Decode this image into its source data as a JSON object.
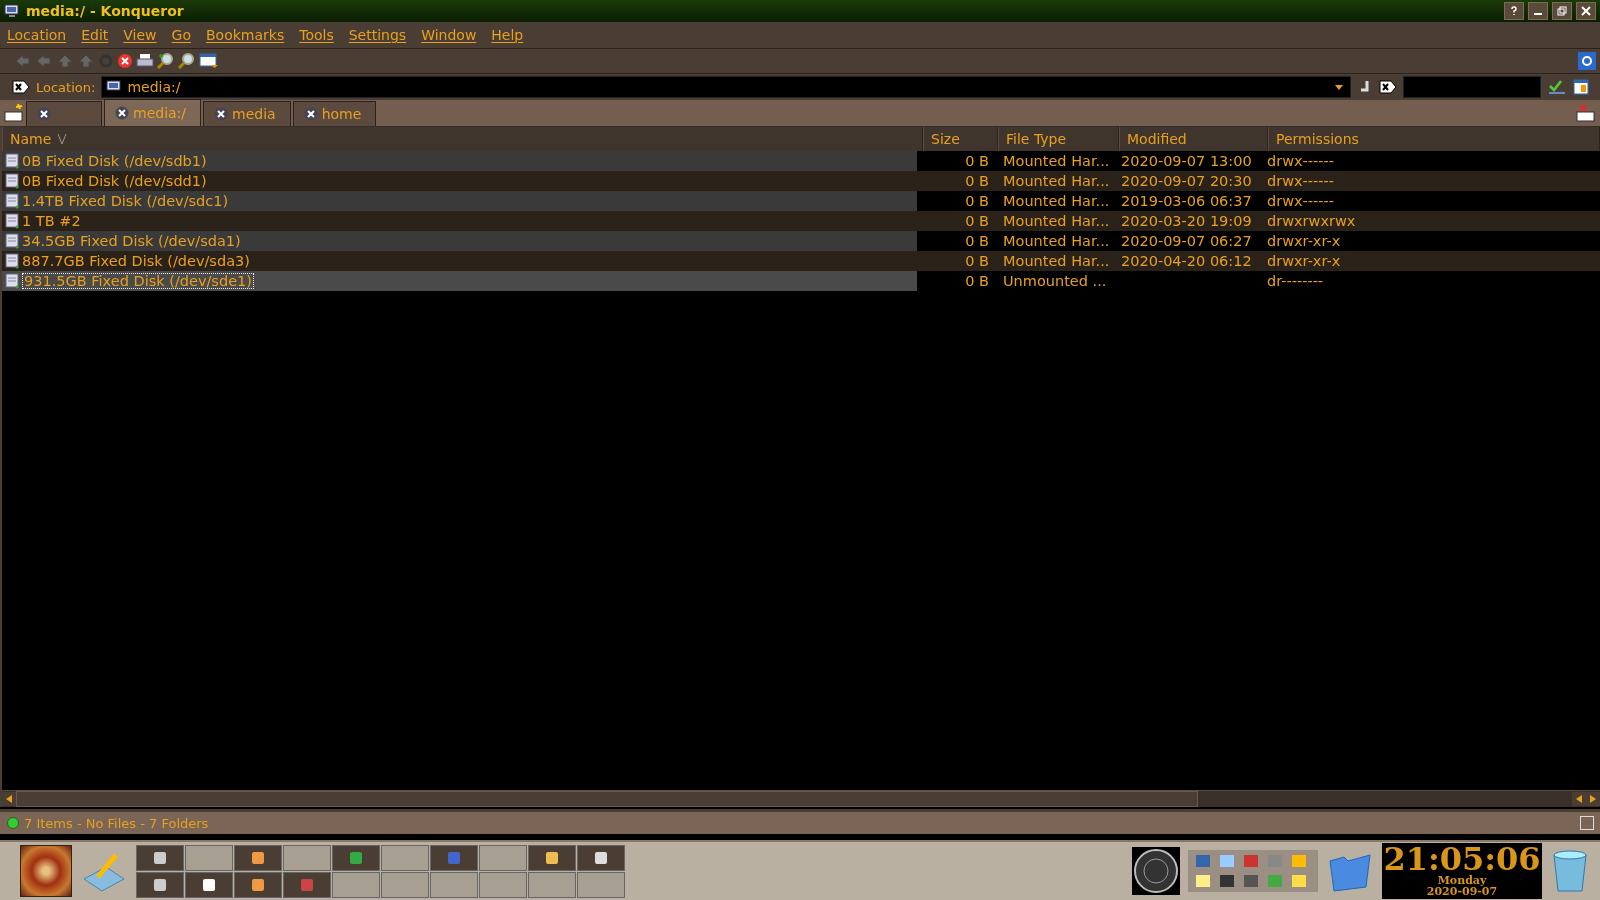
{
  "window": {
    "title": "media:/ - Konqueror"
  },
  "menu": [
    "Location",
    "Edit",
    "View",
    "Go",
    "Bookmarks",
    "Tools",
    "Settings",
    "Window",
    "Help"
  ],
  "location": {
    "label": "Location:",
    "value": "media:/"
  },
  "tabs": [
    {
      "selected": false
    },
    {
      "label": "media:/",
      "selected": true
    },
    {
      "label": "media",
      "selected": false
    },
    {
      "label": "home",
      "selected": false
    }
  ],
  "table": {
    "columns": [
      "Name",
      "Size",
      "File Type",
      "Modified",
      "Permissions"
    ],
    "rows": [
      {
        "name": "0B Fixed Disk (/dev/sdb1)",
        "size": "0 B",
        "type": "Mounted Har...",
        "modified": "2020-09-07 13:00",
        "permissions": "drwx------",
        "selected": false
      },
      {
        "name": "0B Fixed Disk (/dev/sdd1)",
        "size": "0 B",
        "type": "Mounted Har...",
        "modified": "2020-09-07 20:30",
        "permissions": "drwx------",
        "selected": false
      },
      {
        "name": "1.4TB Fixed Disk (/dev/sdc1)",
        "size": "0 B",
        "type": "Mounted Har...",
        "modified": "2019-03-06 06:37",
        "permissions": "drwx------",
        "selected": false
      },
      {
        "name": "1 TB #2",
        "size": "0 B",
        "type": "Mounted Har...",
        "modified": "2020-03-20 19:09",
        "permissions": "drwxrwxrwx",
        "selected": false
      },
      {
        "name": "34.5GB Fixed Disk (/dev/sda1)",
        "size": "0 B",
        "type": "Mounted Har...",
        "modified": "2020-09-07 06:27",
        "permissions": "drwxr-xr-x",
        "selected": false
      },
      {
        "name": "887.7GB Fixed Disk (/dev/sda3)",
        "size": "0 B",
        "type": "Mounted Har...",
        "modified": "2020-04-20 06:12",
        "permissions": "drwxr-xr-x",
        "selected": false
      },
      {
        "name": "931.5GB Fixed Disk (/dev/sde1)",
        "size": "0 B",
        "type": "Unmounted ...",
        "permissions": "dr--------",
        "selected": true
      }
    ]
  },
  "status_bar": "7 Items - No Files - 7 Folders",
  "clock": {
    "time": "21:05:06",
    "day": "Monday",
    "date": "2020-09-07"
  }
}
